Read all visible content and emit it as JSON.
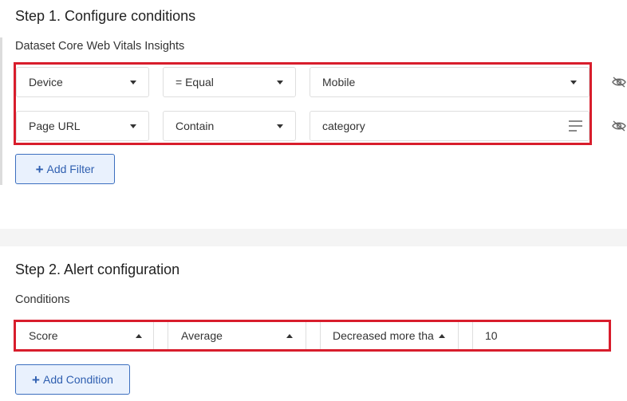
{
  "step1": {
    "title": "Step 1. Configure conditions",
    "dataset_label": "Dataset Core Web Vitals Insights",
    "filters": [
      {
        "field": "Device",
        "operator": "= Equal",
        "value": "Mobile",
        "value_control": "dropdown"
      },
      {
        "field": "Page URL",
        "operator": "Contain",
        "value": "category",
        "value_control": "text-input"
      }
    ],
    "add_filter_label": "Add Filter"
  },
  "step2": {
    "title": "Step 2. Alert configuration",
    "conditions_label": "Conditions",
    "condition": {
      "metric": "Score",
      "aggregation": "Average",
      "comparison": "Decreased more tha",
      "threshold": "10"
    },
    "add_condition_label": "Add Condition"
  },
  "colors": {
    "highlight": "#d81d2c",
    "button_border": "#3c6fbf",
    "button_bg": "#e9f1fd",
    "button_text": "#2f5fb0"
  },
  "icons": {
    "filter_visibility": "eye-slash-icon",
    "add": "plus-icon",
    "select_caret": "chevron-down-icon",
    "menu": "hamburger-icon"
  }
}
